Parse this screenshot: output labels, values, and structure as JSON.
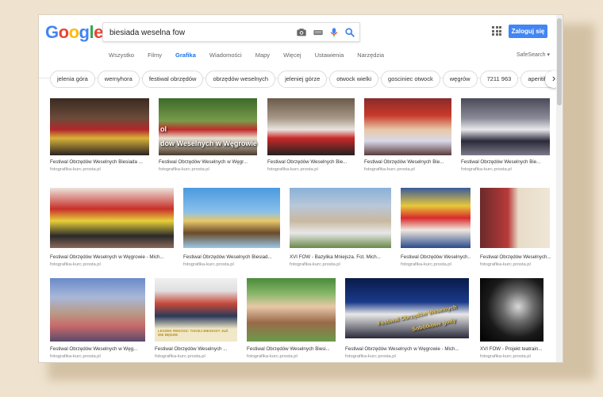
{
  "logo": "Google",
  "search": {
    "value": "biesiada weselna fow"
  },
  "header": {
    "login_label": "Zaloguj się",
    "safesearch_label": "SafeSearch ▾"
  },
  "tabs": [
    "Wszystko",
    "Filmy",
    "Grafika",
    "Wiadomości",
    "Mapy",
    "Więcej",
    "Ustawienia",
    "Narzędzia"
  ],
  "chips": [
    "jelenia góra",
    "wernyhora",
    "festiwal obrzędów",
    "obrzędów weselnych",
    "jeleniej górze",
    "otwock wielki",
    "gosciniec otwock",
    "węgrów",
    "7211 963",
    "aperitif lampka"
  ],
  "results": [
    {
      "caption": "Festiwal Obrzędów Weselnych Biesiada ...",
      "source": "fotografika-kurc.prosta.pl"
    },
    {
      "caption": "Festiwal Obrzędów Weselnych w Węgr...",
      "source": "fotografika-kurc.prosta.pl",
      "overlay": "dow Weselnych w Węgrowie",
      "overlay_top": "ol"
    },
    {
      "caption": "Festiwal Obrzędów Weselnych Bie...",
      "source": "fotografika-kurc.prosta.pl"
    },
    {
      "caption": "Festiwal Obrzędów Weselnych Bie...",
      "source": "fotografika-kurc.prosta.pl"
    },
    {
      "caption": "Festiwal Obrzędów Weselnych Bie...",
      "source": "fotografika-kurc.prosta.pl"
    },
    {
      "caption": "Festiwal Obrzędów Weselnych w Węgrowie - Mich...",
      "source": "fotografika-kurc.prosta.pl"
    },
    {
      "caption": "Festiwal Obrzędów Weselnych Biesiad...",
      "source": "fotografika-kurc.prosta.pl"
    },
    {
      "caption": "XVI FOW - Bazylika Mniejsza. Fot. Mich...",
      "source": "fotografika-kurc.prosta.pl"
    },
    {
      "caption": "Festiwal Obrzędów Weselnych...",
      "source": "fotografika-kurc.prosta.pl"
    },
    {
      "caption": "Festiwal Obrzędów Weselnych...",
      "source": "fotografika-kurc.prosta.pl"
    },
    {
      "caption": "Festiwal Obrzędów Weselnych w Węg...",
      "source": "fotografika-kurc.prosta.pl"
    },
    {
      "caption": "Festiwal Obrzędów Weselnych ...",
      "source": "fotografika-kurc.prosta.pl",
      "banner": "LESZEK REDOSZ: TAKIEJ BIESIADY JUŻ NIE BĘDZIE"
    },
    {
      "caption": "Festiwal Obrzędów Weselnych Biesi...",
      "source": "fotografika-kurc.prosta.pl"
    },
    {
      "caption": "Festiwal Obrzędów Weselnych w Węgrowie - Mich...",
      "source": "fotografika-kurc.prosta.pl",
      "overlay": "Festiwal Obrzędów Weselnych",
      "overlay_top": "Sobótkowe gody"
    },
    {
      "caption": "XVI FOW - Projekt teatrain...",
      "source": "fotografika-kurc.prosta.pl"
    }
  ],
  "colors": {
    "accent": "#1a73e8",
    "button": "#4285f4",
    "background": "#efe3cf"
  }
}
